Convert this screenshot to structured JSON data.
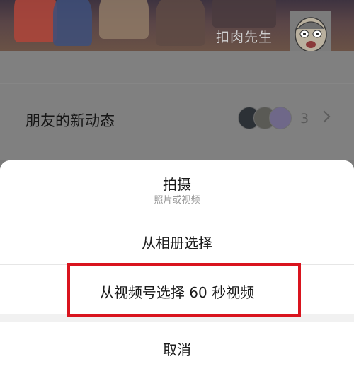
{
  "profile": {
    "nickname": "扣肉先生"
  },
  "feed": {
    "label": "朋友的新动态",
    "count": "3"
  },
  "action_sheet": {
    "shoot": {
      "label": "拍摄",
      "sublabel": "照片或视频"
    },
    "album": {
      "label": "从相册选择"
    },
    "channels": {
      "label": "从视频号选择 60 秒视频"
    },
    "cancel": {
      "label": "取消"
    }
  },
  "highlight_color": "#d9141e",
  "icons": [
    "chevron-right-icon",
    "cartoon-avatar"
  ]
}
